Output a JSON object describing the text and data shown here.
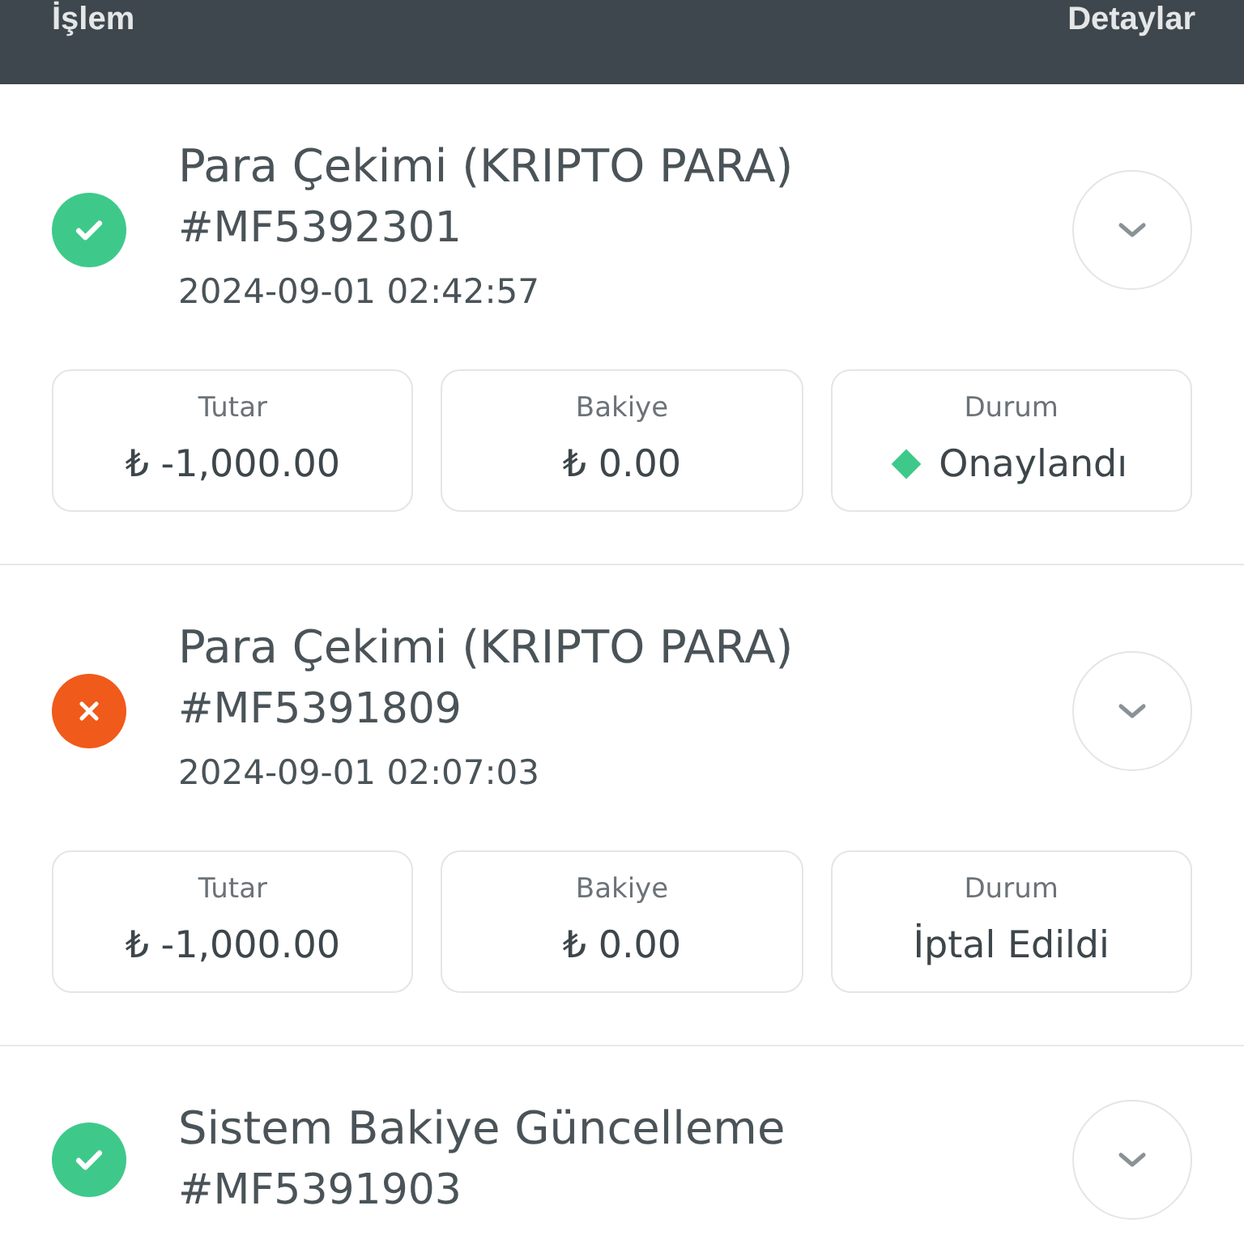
{
  "header": {
    "left": "İşlem",
    "right": "Detaylar"
  },
  "transactions": [
    {
      "kind": "success",
      "title": "Para Çekimi (KRIPTO PARA)",
      "id": "#MF5392301",
      "date": "2024-09-01 02:42:57",
      "fields": [
        {
          "label": "Tutar",
          "value": "₺ -1,000.00"
        },
        {
          "label": "Bakiye",
          "value": "₺ 0.00"
        },
        {
          "label": "Durum",
          "value": "Onaylandı",
          "color": "#3ec98a"
        }
      ]
    },
    {
      "kind": "failed",
      "title": "Para Çekimi (KRIPTO PARA)",
      "id": "#MF5391809",
      "date": "2024-09-01 02:07:03",
      "fields": [
        {
          "label": "Tutar",
          "value": "₺ -1,000.00"
        },
        {
          "label": "Bakiye",
          "value": "₺ 0.00"
        },
        {
          "label": "Durum",
          "value": "İptal Edildi"
        }
      ]
    },
    {
      "kind": "success",
      "title": "Sistem Bakiye Güncelleme",
      "id": "#MF5391903"
    }
  ]
}
